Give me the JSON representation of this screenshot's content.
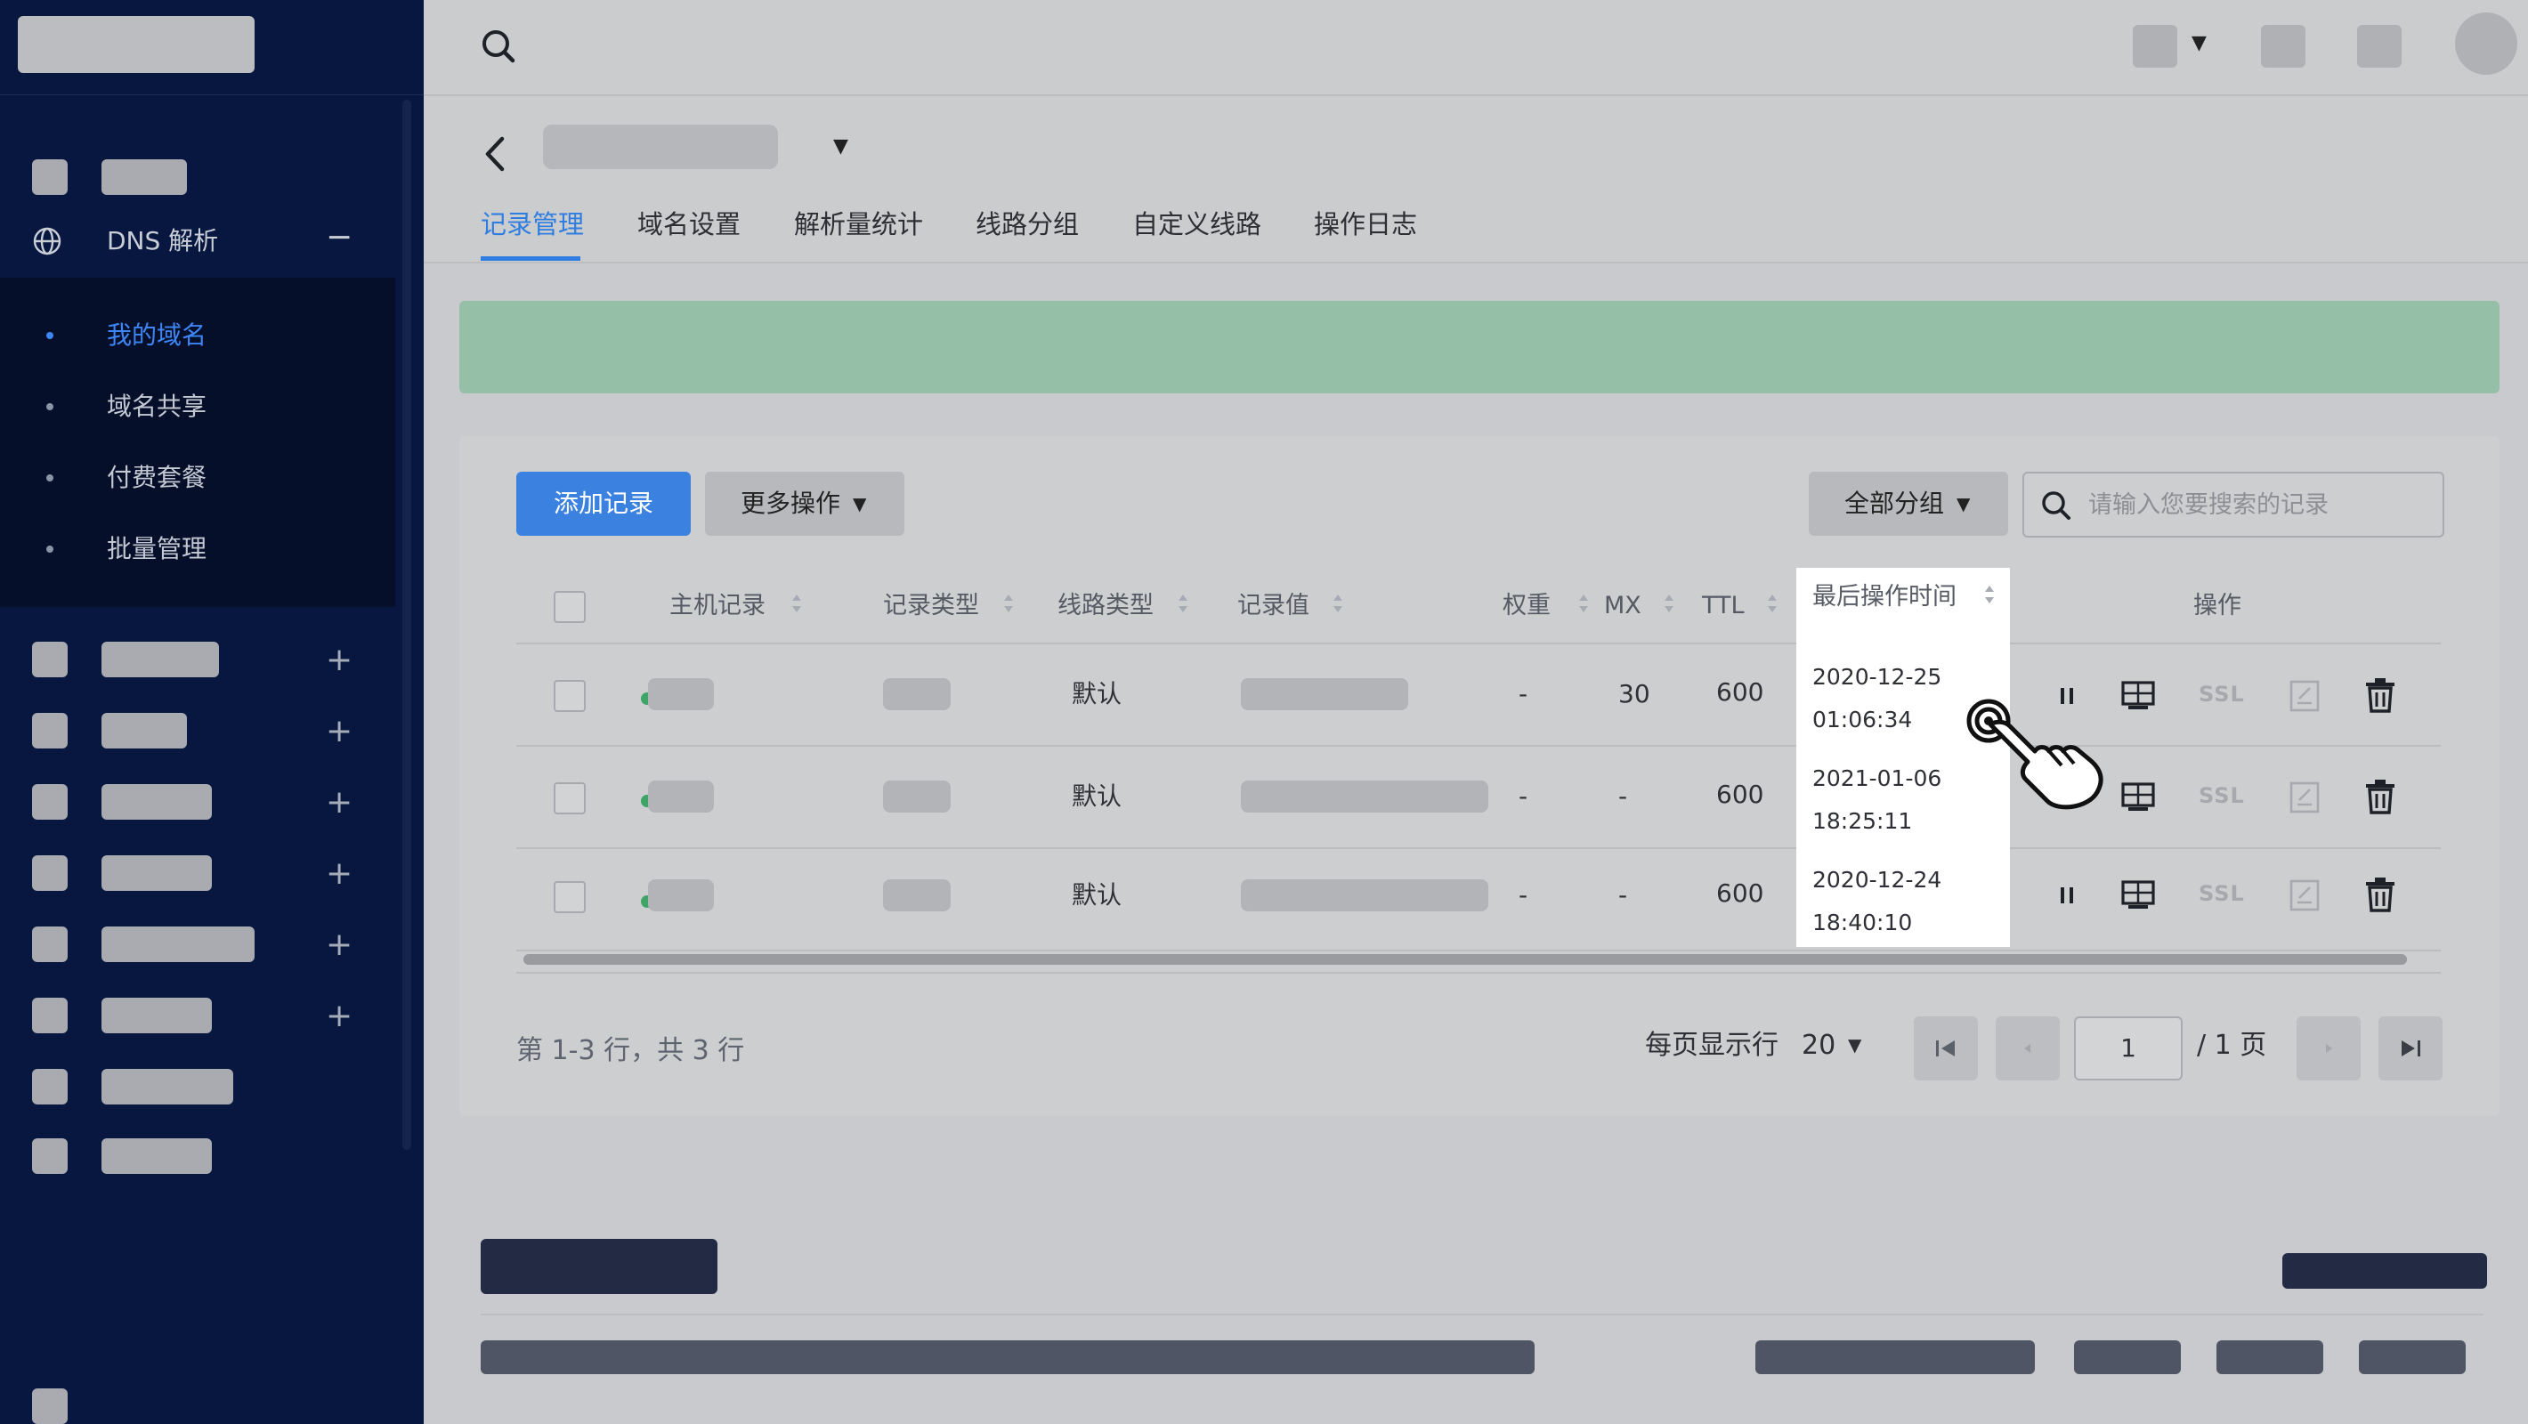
{
  "sidebar": {
    "dns_label": "DNS 解析",
    "dns_toggle": "−",
    "sub_items": [
      "我的域名",
      "域名共享",
      "付费套餐",
      "批量管理"
    ],
    "plus": "+"
  },
  "tabs": [
    "记录管理",
    "域名设置",
    "解析量统计",
    "线路分组",
    "自定义线路",
    "操作日志"
  ],
  "toolbar": {
    "add_label": "添加记录",
    "more_label": "更多操作",
    "group_label": "全部分组",
    "search_placeholder": "请输入您要搜索的记录"
  },
  "table": {
    "headers": {
      "host": "主机记录",
      "type": "记录类型",
      "line": "线路类型",
      "value": "记录值",
      "weight": "权重",
      "mx": "MX",
      "ttl": "TTL",
      "last_op": "最后操作时间",
      "actions": "操作"
    },
    "rows": [
      {
        "line": "默认",
        "weight": "-",
        "mx": "30",
        "ttl": "600",
        "date": "2020-12-25",
        "time": "01:06:34"
      },
      {
        "line": "默认",
        "weight": "-",
        "mx": "-",
        "ttl": "600",
        "date": "2021-01-06",
        "time": "18:25:11"
      },
      {
        "line": "默认",
        "weight": "-",
        "mx": "-",
        "ttl": "600",
        "date": "2020-12-24",
        "time": "18:40:10"
      }
    ],
    "ssl_label": "SSL"
  },
  "pagination": {
    "summary": "第 1-3 行，共 3 行",
    "per_page_label": "每页显示行",
    "page_size": "20",
    "current_page": "1",
    "total_label": "/ 1 页"
  },
  "colors": {
    "sidebar_bg": "#07173f",
    "accent": "#3b82e0",
    "banner": "#96bfa8",
    "status_dot": "#3fa567"
  },
  "icons": [
    "search-icon",
    "globe-icon",
    "back-arrow-icon",
    "pause-icon",
    "monitor-icon",
    "edit-note-icon",
    "trash-icon",
    "hand-cursor-icon",
    "first-page-icon",
    "prev-page-icon",
    "next-page-icon",
    "last-page-icon"
  ]
}
